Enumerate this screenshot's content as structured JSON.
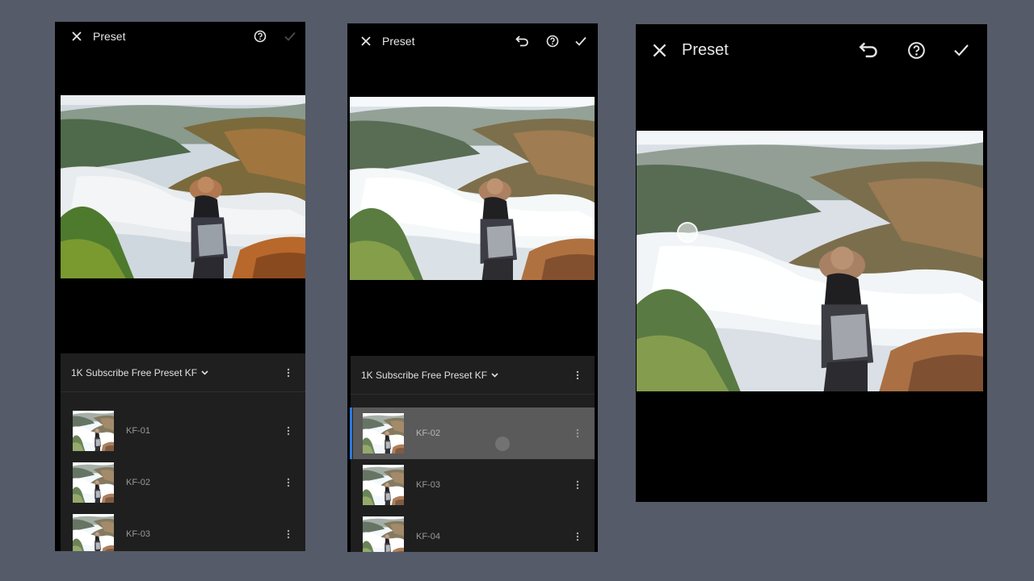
{
  "colors": {
    "background": "#555b68",
    "screen": "#000000",
    "panel": "#1f1f1f",
    "selected_row": "#5a5a5a",
    "accent": "#2d7ae0",
    "text_primary": "#e6e6e6",
    "text_secondary": "#9a9a9a"
  },
  "screens": [
    {
      "title": "Preset",
      "icons": {
        "close": "close-icon",
        "help": "help-circle-icon",
        "confirm": "checkmark-icon"
      },
      "confirm_enabled": false,
      "preset_group": "1K Subscribe Free Preset KF",
      "presets": [
        {
          "label": "KF-01",
          "selected": false
        },
        {
          "label": "KF-02",
          "selected": false
        },
        {
          "label": "KF-03",
          "selected": false
        }
      ]
    },
    {
      "title": "Preset",
      "icons": {
        "close": "close-icon",
        "undo": "undo-icon",
        "help": "help-circle-icon",
        "confirm": "checkmark-icon"
      },
      "confirm_enabled": true,
      "preset_group": "1K Subscribe Free Preset KF",
      "presets": [
        {
          "label": "KF-02",
          "selected": true
        },
        {
          "label": "KF-03",
          "selected": false
        },
        {
          "label": "KF-04",
          "selected": false
        }
      ]
    },
    {
      "title": "Preset",
      "icons": {
        "close": "close-icon",
        "undo": "undo-icon",
        "help": "help-circle-icon",
        "confirm": "checkmark-icon"
      },
      "confirm_enabled": true
    }
  ]
}
